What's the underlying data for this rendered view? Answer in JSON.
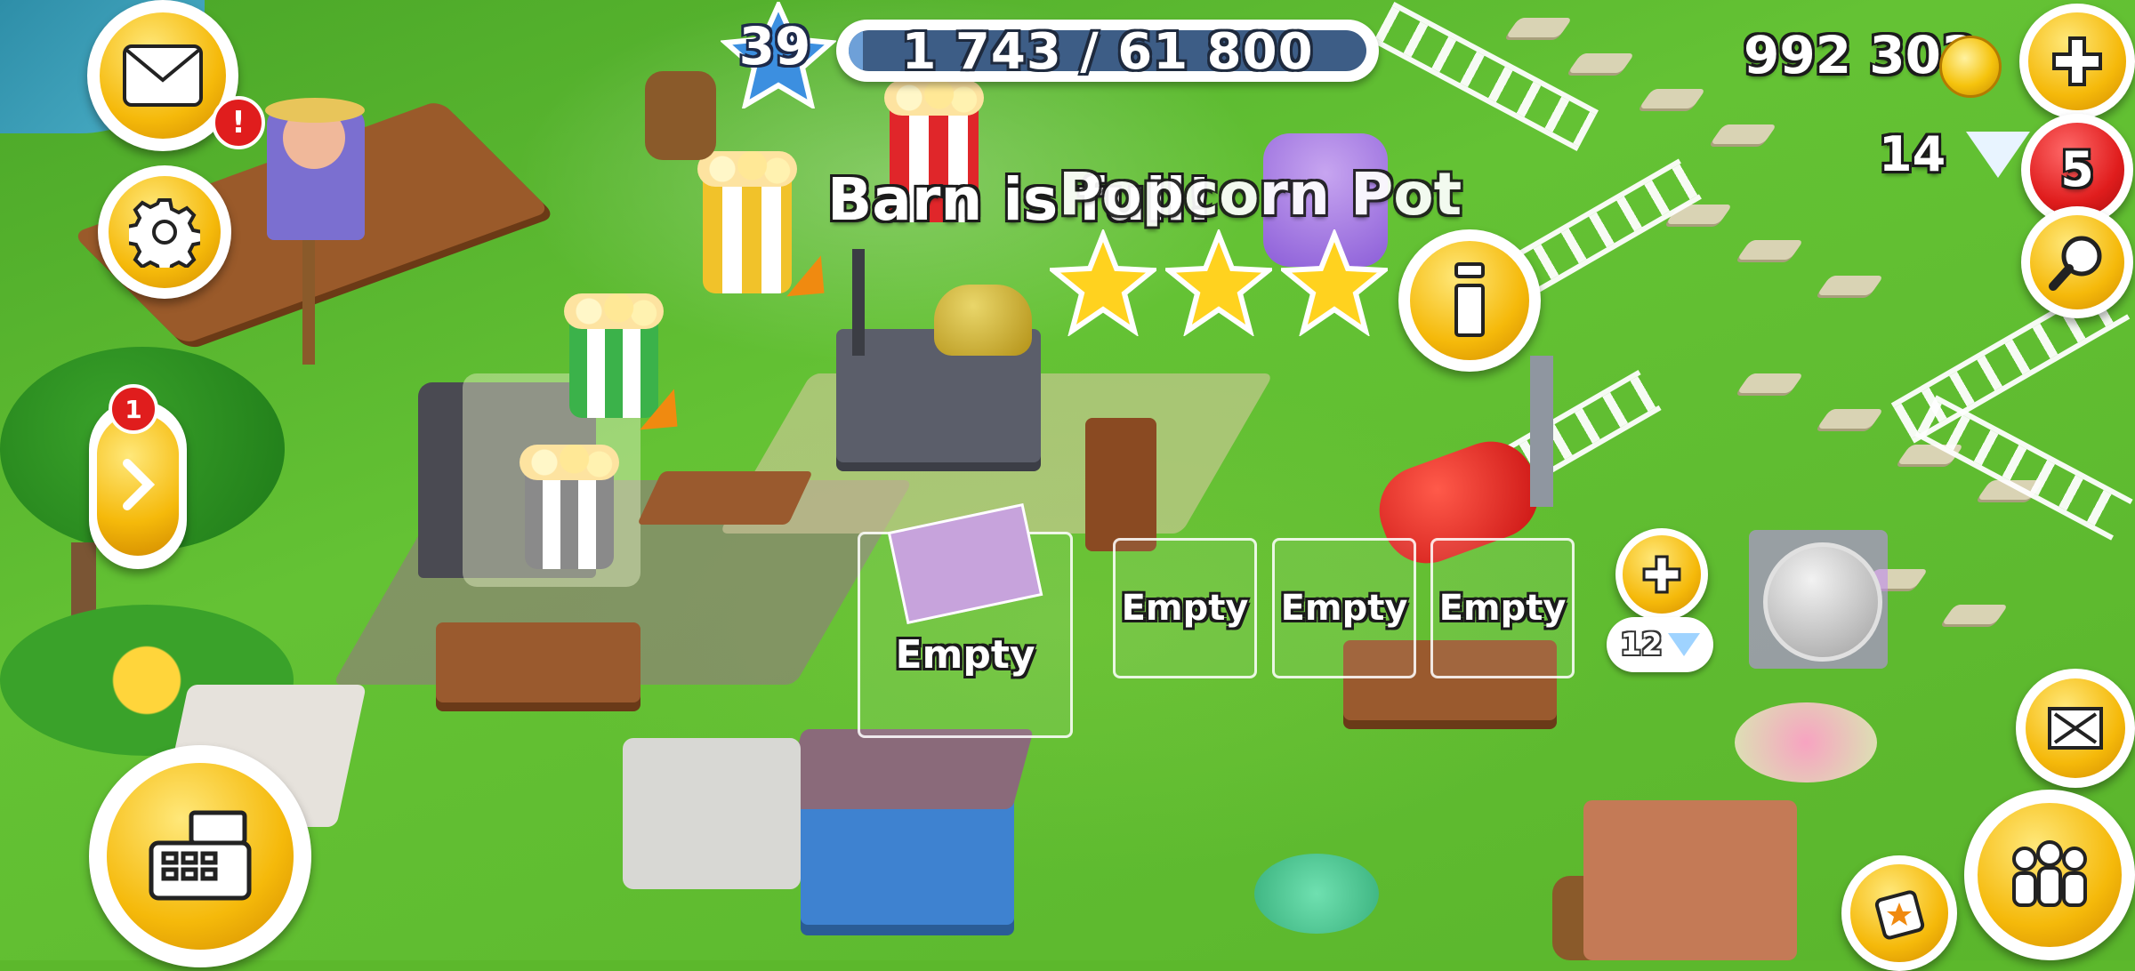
{
  "hud": {
    "level": "39",
    "xp_text": "1 743 / 61 800",
    "xp_progress": 0.028,
    "coins": "992 303",
    "gems": "14",
    "gems_badge": "5",
    "mail_badge": "!",
    "side_panel_badge": "1"
  },
  "production": {
    "notice": "Barn is full!",
    "machine_name": "Popcorn Pot",
    "stars_earned": 3,
    "slots": [
      {
        "label": "Empty"
      },
      {
        "label": "Empty"
      },
      {
        "label": "Empty"
      },
      {
        "label": "Empty"
      }
    ],
    "unlock_slot_price": "12"
  },
  "icons": {
    "mail": "envelope-icon",
    "settings": "gear-icon",
    "side_panel": "chevron-right-icon",
    "shop": "cash-register-icon",
    "add_coins": "plus-icon",
    "search": "magnifier-icon",
    "info": "info-icon",
    "edit_mode": "expand-arrows-icon",
    "friends": "people-icon",
    "cards": "star-card-icon"
  },
  "colors": {
    "button_gold": "#f5b90a",
    "badge_red": "#e01d1d",
    "xp_track": "#3d5d86",
    "grass": "#5cb82c"
  }
}
